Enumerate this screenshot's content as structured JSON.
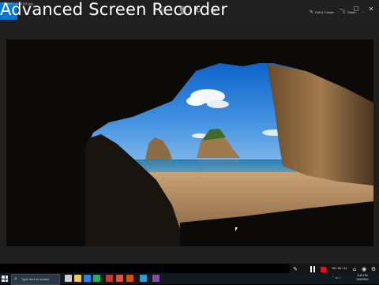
{
  "window_title": "Photos – img1920.jpg",
  "brand_overlay": "Advanced Screen Recorder",
  "toolbar": {
    "edit_create": "Edit & Create",
    "share": "Share",
    "more": "…"
  },
  "recorder": {
    "timer": "00:00:34"
  },
  "taskbar": {
    "search_placeholder": "Type here to search",
    "time": "3:40 PM",
    "date": "10/6/2021"
  },
  "colors": {
    "accent": "#0078d7",
    "stop": "#e81123"
  }
}
